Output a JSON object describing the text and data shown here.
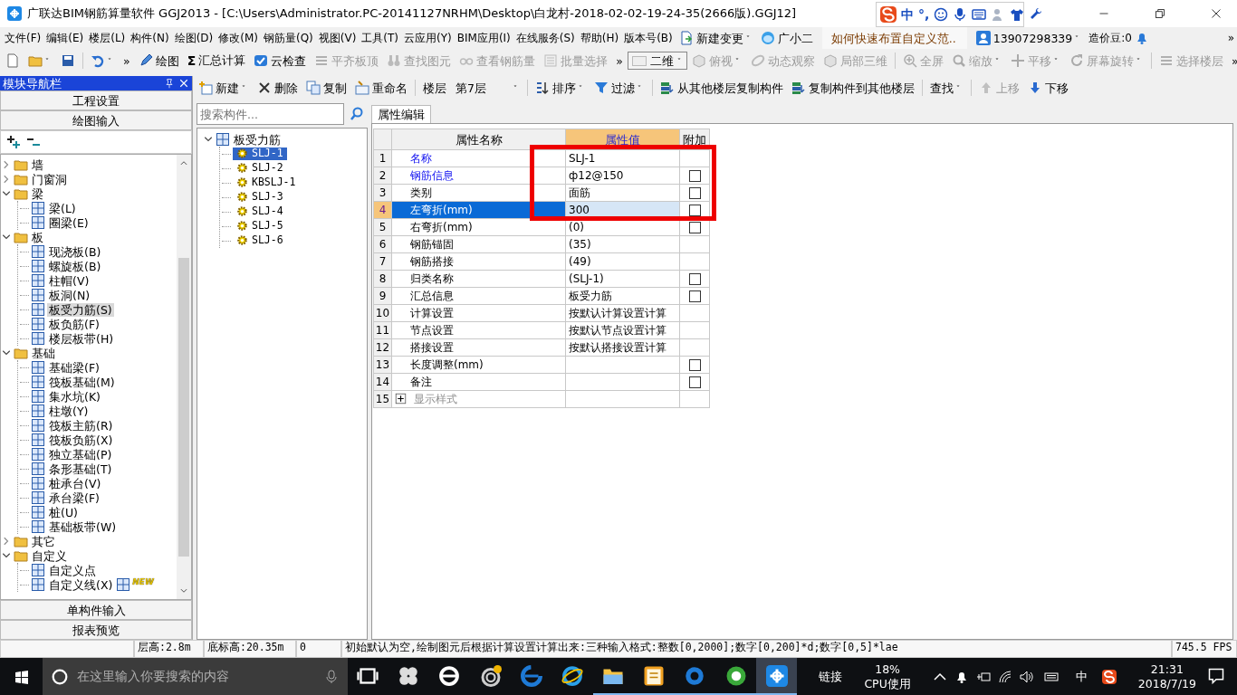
{
  "title_bar": {
    "title": "广联达BIM钢筋算量软件 GGJ2013 - [C:\\Users\\Administrator.PC-20141127NRHM\\Desktop\\白龙村-2018-02-02-19-24-35(2666版).GGJ12]"
  },
  "ime_bar": {
    "mode": "中",
    "punct": "°,"
  },
  "menu": {
    "items": [
      "文件(F)",
      "编辑(E)",
      "楼层(L)",
      "构件(N)",
      "绘图(D)",
      "修改(M)",
      "钢筋量(Q)",
      "视图(V)",
      "工具(T)",
      "云应用(Y)",
      "BIM应用(I)",
      "在线服务(S)",
      "帮助(H)",
      "版本号(B)"
    ],
    "new_change": "新建变更",
    "assistant": "广小二",
    "question": "如何快速布置自定义范..",
    "account": "13907298339",
    "beans": "造价豆:0",
    "overflow": "»"
  },
  "toolbar": [
    {
      "kind": "icon",
      "dropdown": false
    },
    {
      "kind": "icon",
      "dropdown": true
    },
    {
      "kind": "icon",
      "dropdown": false
    },
    {
      "kind": "separator"
    },
    {
      "kind": "icon",
      "dropdown": true
    },
    {
      "kind": "overflow",
      "label": "»"
    },
    {
      "kind": "button",
      "label": "绘图",
      "disabled": false,
      "dropdown": false
    },
    {
      "kind": "button",
      "label": "汇总计算",
      "symbol": "Σ",
      "disabled": false,
      "dropdown": false
    },
    {
      "kind": "button",
      "label": "云检查",
      "disabled": false,
      "dropdown": false
    },
    {
      "kind": "button",
      "label": "平齐板顶",
      "disabled": true,
      "dropdown": false
    },
    {
      "kind": "button",
      "label": "查找图元",
      "disabled": true,
      "dropdown": false
    },
    {
      "kind": "button",
      "label": "查看钢筋量",
      "disabled": true,
      "dropdown": false
    },
    {
      "kind": "button",
      "label": "批量选择",
      "disabled": true,
      "dropdown": false
    },
    {
      "kind": "overflow",
      "label": "»"
    },
    {
      "kind": "combo",
      "label": "二维"
    },
    {
      "kind": "button",
      "label": "俯视",
      "disabled": true,
      "dropdown": true
    },
    {
      "kind": "button",
      "label": "动态观察",
      "disabled": true,
      "dropdown": false
    },
    {
      "kind": "button",
      "label": "局部三维",
      "disabled": true,
      "dropdown": false
    },
    {
      "kind": "separator"
    },
    {
      "kind": "button",
      "label": "全屏",
      "disabled": true,
      "dropdown": false
    },
    {
      "kind": "button",
      "label": "缩放",
      "disabled": true,
      "dropdown": true
    },
    {
      "kind": "button",
      "label": "平移",
      "disabled": true,
      "dropdown": true
    },
    {
      "kind": "button",
      "label": "屏幕旋转",
      "disabled": true,
      "dropdown": true
    },
    {
      "kind": "separator"
    },
    {
      "kind": "button",
      "label": "选择楼层",
      "disabled": true,
      "dropdown": false
    },
    {
      "kind": "overflow",
      "label": "»"
    }
  ],
  "nav": {
    "title": "模块导航栏",
    "top_buttons": [
      "工程设置",
      "绘图输入"
    ],
    "tree": [
      {
        "label": "墙",
        "expanded": false
      },
      {
        "label": "门窗洞",
        "expanded": false
      },
      {
        "label": "梁",
        "expanded": true,
        "children": [
          {
            "label": "梁(L)",
            "selected": false
          },
          {
            "label": "圈梁(E)",
            "selected": false
          }
        ]
      },
      {
        "label": "板",
        "expanded": true,
        "children": [
          {
            "label": "现浇板(B)",
            "selected": false
          },
          {
            "label": "螺旋板(B)",
            "selected": false
          },
          {
            "label": "柱帽(V)",
            "selected": false
          },
          {
            "label": "板洞(N)",
            "selected": false
          },
          {
            "label": "板受力筋(S)",
            "selected": true
          },
          {
            "label": "板负筋(F)",
            "selected": false
          },
          {
            "label": "楼层板带(H)",
            "selected": false
          }
        ]
      },
      {
        "label": "基础",
        "expanded": true,
        "children": [
          {
            "label": "基础梁(F)",
            "selected": false
          },
          {
            "label": "筏板基础(M)",
            "selected": false
          },
          {
            "label": "集水坑(K)",
            "selected": false
          },
          {
            "label": "柱墩(Y)",
            "selected": false
          },
          {
            "label": "筏板主筋(R)",
            "selected": false
          },
          {
            "label": "筏板负筋(X)",
            "selected": false
          },
          {
            "label": "独立基础(P)",
            "selected": false
          },
          {
            "label": "条形基础(T)",
            "selected": false
          },
          {
            "label": "桩承台(V)",
            "selected": false
          },
          {
            "label": "承台梁(F)",
            "selected": false
          },
          {
            "label": "桩(U)",
            "selected": false
          },
          {
            "label": "基础板带(W)",
            "selected": false
          }
        ]
      },
      {
        "label": "其它",
        "expanded": false
      },
      {
        "label": "自定义",
        "expanded": true,
        "children": [
          {
            "label": "自定义点",
            "selected": false
          },
          {
            "label": "自定义线(X)",
            "selected": false,
            "badge": "NEW"
          }
        ]
      }
    ],
    "bottom_buttons": [
      "单构件输入",
      "报表预览"
    ]
  },
  "toolbar2": [
    {
      "kind": "button",
      "label": "新建",
      "disabled": false,
      "dropdown": true
    },
    {
      "kind": "button",
      "label": "删除",
      "disabled": false,
      "dropdown": false
    },
    {
      "kind": "button",
      "label": "复制",
      "disabled": false,
      "dropdown": false
    },
    {
      "kind": "button",
      "label": "重命名",
      "disabled": false,
      "dropdown": false
    },
    {
      "kind": "separator"
    },
    {
      "kind": "text",
      "label": "楼层"
    },
    {
      "kind": "combo",
      "label": "第7层"
    },
    {
      "kind": "separator"
    },
    {
      "kind": "button",
      "label": "排序",
      "disabled": false,
      "dropdown": true
    },
    {
      "kind": "button",
      "label": "过滤",
      "disabled": false,
      "dropdown": true
    },
    {
      "kind": "separator"
    },
    {
      "kind": "button",
      "label": "从其他楼层复制构件",
      "disabled": false,
      "dropdown": false
    },
    {
      "kind": "button",
      "label": "复制构件到其他楼层",
      "disabled": false,
      "dropdown": false
    },
    {
      "kind": "separator"
    },
    {
      "kind": "button",
      "label": "查找",
      "disabled": false,
      "dropdown": true
    },
    {
      "kind": "separator"
    },
    {
      "kind": "button",
      "label": "上移",
      "disabled": true,
      "dropdown": false
    },
    {
      "kind": "button",
      "label": "下移",
      "disabled": false,
      "dropdown": false
    }
  ],
  "components": {
    "search_placeholder": "搜索构件...",
    "root": {
      "label": "板受力筋",
      "expanded": true,
      "children": [
        {
          "label": "SLJ-1",
          "selected": true
        },
        {
          "label": "SLJ-2",
          "selected": false
        },
        {
          "label": "KBSLJ-1",
          "selected": false
        },
        {
          "label": "SLJ-3",
          "selected": false
        },
        {
          "label": "SLJ-4",
          "selected": false
        },
        {
          "label": "SLJ-5",
          "selected": false
        },
        {
          "label": "SLJ-6",
          "selected": false
        }
      ]
    }
  },
  "properties": {
    "tab": "属性编辑",
    "columns": [
      "属性名称",
      "属性值",
      "附加"
    ],
    "rows": [
      {
        "kind": "field",
        "num": "1",
        "name": "名称",
        "value": "SLJ-1",
        "public": true,
        "selected": false
      },
      {
        "kind": "field",
        "num": "2",
        "name": "钢筋信息",
        "value": "ф12@150",
        "public": true,
        "checked": false,
        "selected": false
      },
      {
        "kind": "field",
        "num": "3",
        "name": "类别",
        "value": "面筋",
        "public": false,
        "checked": false,
        "selected": false
      },
      {
        "kind": "field",
        "num": "4",
        "name": "左弯折(mm)",
        "value": "300",
        "public": false,
        "checked": false,
        "selected": true
      },
      {
        "kind": "field",
        "num": "5",
        "name": "右弯折(mm)",
        "value": "(0)",
        "public": false,
        "checked": false,
        "selected": false
      },
      {
        "kind": "field",
        "num": "6",
        "name": "钢筋锚固",
        "value": "(35)",
        "public": false,
        "selected": false
      },
      {
        "kind": "field",
        "num": "7",
        "name": "钢筋搭接",
        "value": "(49)",
        "public": false,
        "selected": false
      },
      {
        "kind": "field",
        "num": "8",
        "name": "归类名称",
        "value": "(SLJ-1)",
        "public": false,
        "checked": false,
        "selected": false
      },
      {
        "kind": "field",
        "num": "9",
        "name": "汇总信息",
        "value": "板受力筋",
        "public": false,
        "checked": false,
        "selected": false
      },
      {
        "kind": "field",
        "num": "10",
        "name": "计算设置",
        "value": "按默认计算设置计算",
        "public": false,
        "selected": false
      },
      {
        "kind": "field",
        "num": "11",
        "name": "节点设置",
        "value": "按默认节点设置计算",
        "public": false,
        "selected": false
      },
      {
        "kind": "field",
        "num": "12",
        "name": "搭接设置",
        "value": "按默认搭接设置计算",
        "public": false,
        "selected": false
      },
      {
        "kind": "field",
        "num": "13",
        "name": "长度调整(mm)",
        "public": false,
        "checked": false,
        "selected": false
      },
      {
        "kind": "field",
        "num": "14",
        "name": "备注",
        "public": false,
        "checked": false,
        "selected": false
      },
      {
        "kind": "group",
        "num": "15",
        "name": "显示样式",
        "expanded": false,
        "selected": false
      }
    ]
  },
  "status_bar": [
    "层高:2.8m",
    "底标高:20.35m",
    "0",
    "初始默认为空,绘制图元后根据计算设置计算出来:三种输入格式:整数[0,2000];数字[0,200]*d;数字[0,5]*lae",
    "745.5 FPS"
  ],
  "taskbar": {
    "search_placeholder": "在这里输入你要搜索的内容",
    "apps": [
      {
        "running": false,
        "active": false
      },
      {
        "running": false,
        "active": false
      },
      {
        "running": false,
        "active": false
      },
      {
        "running": false,
        "active": false
      },
      {
        "running": false,
        "active": false
      },
      {
        "running": false,
        "active": false
      },
      {
        "running": true,
        "active": false
      },
      {
        "running": true,
        "active": false
      },
      {
        "running": true,
        "active": false
      },
      {
        "running": true,
        "active": false
      },
      {
        "running": true,
        "active": true
      }
    ],
    "link_label": "链接",
    "cpu_percent": "18%",
    "cpu_label": "CPU使用",
    "ime": "中",
    "time": "21:31",
    "date": "2018/7/19"
  }
}
